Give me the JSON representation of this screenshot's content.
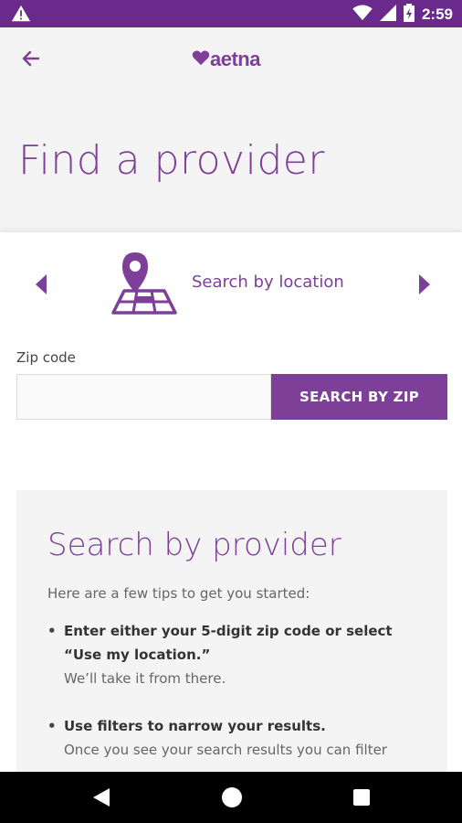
{
  "status_bar": {
    "time": "2:59",
    "icons": [
      "warning-icon",
      "wifi-icon",
      "signal-icon",
      "battery-icon"
    ]
  },
  "app_bar": {
    "back_icon": "arrow-left-icon",
    "logo_text": "aetna",
    "logo_icon": "heart-icon"
  },
  "page_title": "Find a provider",
  "search_mode": {
    "label": "Search by location",
    "icon": "map-pin-icon"
  },
  "zip": {
    "label": "Zip code",
    "value": "",
    "placeholder": "",
    "button_label": "SEARCH BY ZIP"
  },
  "tips": {
    "title": "Search by provider",
    "intro": "Here are a few tips to get you started:",
    "items": [
      {
        "strong": "Enter either your 5-digit zip code or select “Use my location.”",
        "sub": "We’ll take it from there."
      },
      {
        "strong": "Use filters to narrow your results.",
        "sub": "Once you see your search results you can filter"
      }
    ]
  },
  "colors": {
    "brand_purple": "#7d3f98",
    "status_bar": "#6a2a8c"
  }
}
